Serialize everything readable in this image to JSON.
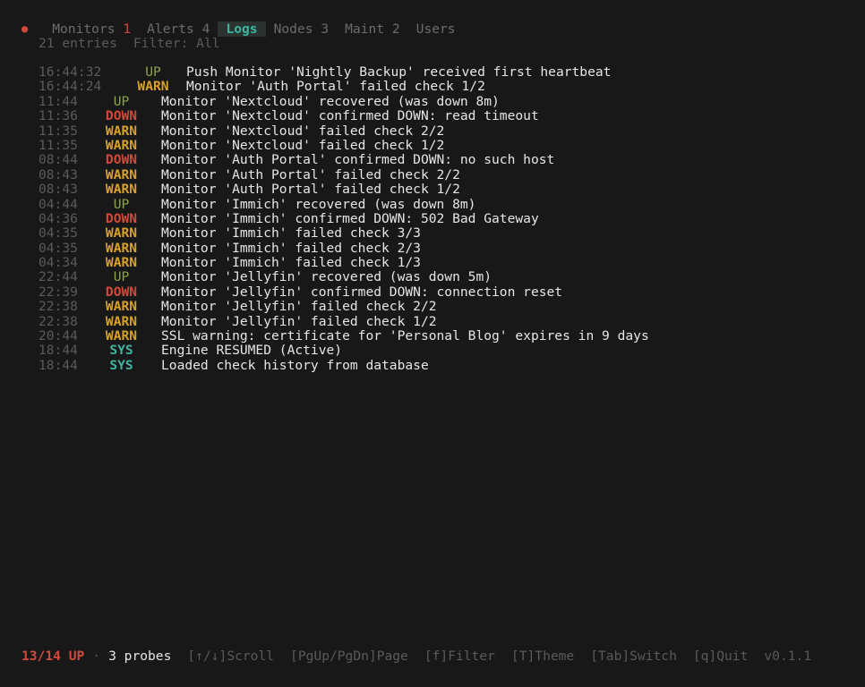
{
  "header": {
    "status_dot": "●",
    "tabs": [
      {
        "label": "Monitors",
        "count": "1",
        "count_alert": true
      },
      {
        "label": "Alerts",
        "count": "4"
      },
      {
        "label": "Logs",
        "count": ""
      },
      {
        "label": "Nodes",
        "count": "3"
      },
      {
        "label": "Maint",
        "count": "2"
      },
      {
        "label": "Users",
        "count": ""
      }
    ],
    "active_tab": "Logs"
  },
  "summary": {
    "entries": "21 entries",
    "filter": "Filter: All"
  },
  "logs": [
    {
      "time": "16:44:32",
      "level": "UP",
      "message": "Push Monitor 'Nightly Backup' received first heartbeat"
    },
    {
      "time": "16:44:24",
      "level": "WARN",
      "message": "Monitor 'Auth Portal' failed check 1/2"
    },
    {
      "time": "11:44",
      "level": "UP",
      "message": "Monitor 'Nextcloud' recovered (was down 8m)"
    },
    {
      "time": "11:36",
      "level": "DOWN",
      "message": "Monitor 'Nextcloud' confirmed DOWN: read timeout"
    },
    {
      "time": "11:35",
      "level": "WARN",
      "message": "Monitor 'Nextcloud' failed check 2/2"
    },
    {
      "time": "11:35",
      "level": "WARN",
      "message": "Monitor 'Nextcloud' failed check 1/2"
    },
    {
      "time": "08:44",
      "level": "DOWN",
      "message": "Monitor 'Auth Portal' confirmed DOWN: no such host"
    },
    {
      "time": "08:43",
      "level": "WARN",
      "message": "Monitor 'Auth Portal' failed check 2/2"
    },
    {
      "time": "08:43",
      "level": "WARN",
      "message": "Monitor 'Auth Portal' failed check 1/2"
    },
    {
      "time": "04:44",
      "level": "UP",
      "message": "Monitor 'Immich' recovered (was down 8m)"
    },
    {
      "time": "04:36",
      "level": "DOWN",
      "message": "Monitor 'Immich' confirmed DOWN: 502 Bad Gateway"
    },
    {
      "time": "04:35",
      "level": "WARN",
      "message": "Monitor 'Immich' failed check 3/3"
    },
    {
      "time": "04:35",
      "level": "WARN",
      "message": "Monitor 'Immich' failed check 2/3"
    },
    {
      "time": "04:34",
      "level": "WARN",
      "message": "Monitor 'Immich' failed check 1/3"
    },
    {
      "time": "22:44",
      "level": "UP",
      "message": "Monitor 'Jellyfin' recovered (was down 5m)"
    },
    {
      "time": "22:39",
      "level": "DOWN",
      "message": "Monitor 'Jellyfin' confirmed DOWN: connection reset"
    },
    {
      "time": "22:38",
      "level": "WARN",
      "message": "Monitor 'Jellyfin' failed check 2/2"
    },
    {
      "time": "22:38",
      "level": "WARN",
      "message": "Monitor 'Jellyfin' failed check 1/2"
    },
    {
      "time": "20:44",
      "level": "WARN",
      "message": "SSL warning: certificate for 'Personal Blog' expires in 9 days"
    },
    {
      "time": "18:44",
      "level": "SYS",
      "message": "Engine RESUMED (Active)"
    },
    {
      "time": "18:44",
      "level": "SYS",
      "message": "Loaded check history from database"
    }
  ],
  "footer": {
    "up_status": "13/14 UP",
    "separator": "·",
    "probes": "3 probes",
    "keys": [
      "[↑/↓]Scroll",
      "[PgUp/PgDn]Page",
      "[f]Filter",
      "[T]Theme",
      "[Tab]Switch",
      "[q]Quit"
    ],
    "version": "v0.1.1"
  },
  "colors": {
    "background": "#181818",
    "up": "#8aa34a",
    "down": "#d04a3c",
    "warn": "#d6a22a",
    "sys": "#3fb4a0",
    "dim": "#5a5a5a"
  }
}
